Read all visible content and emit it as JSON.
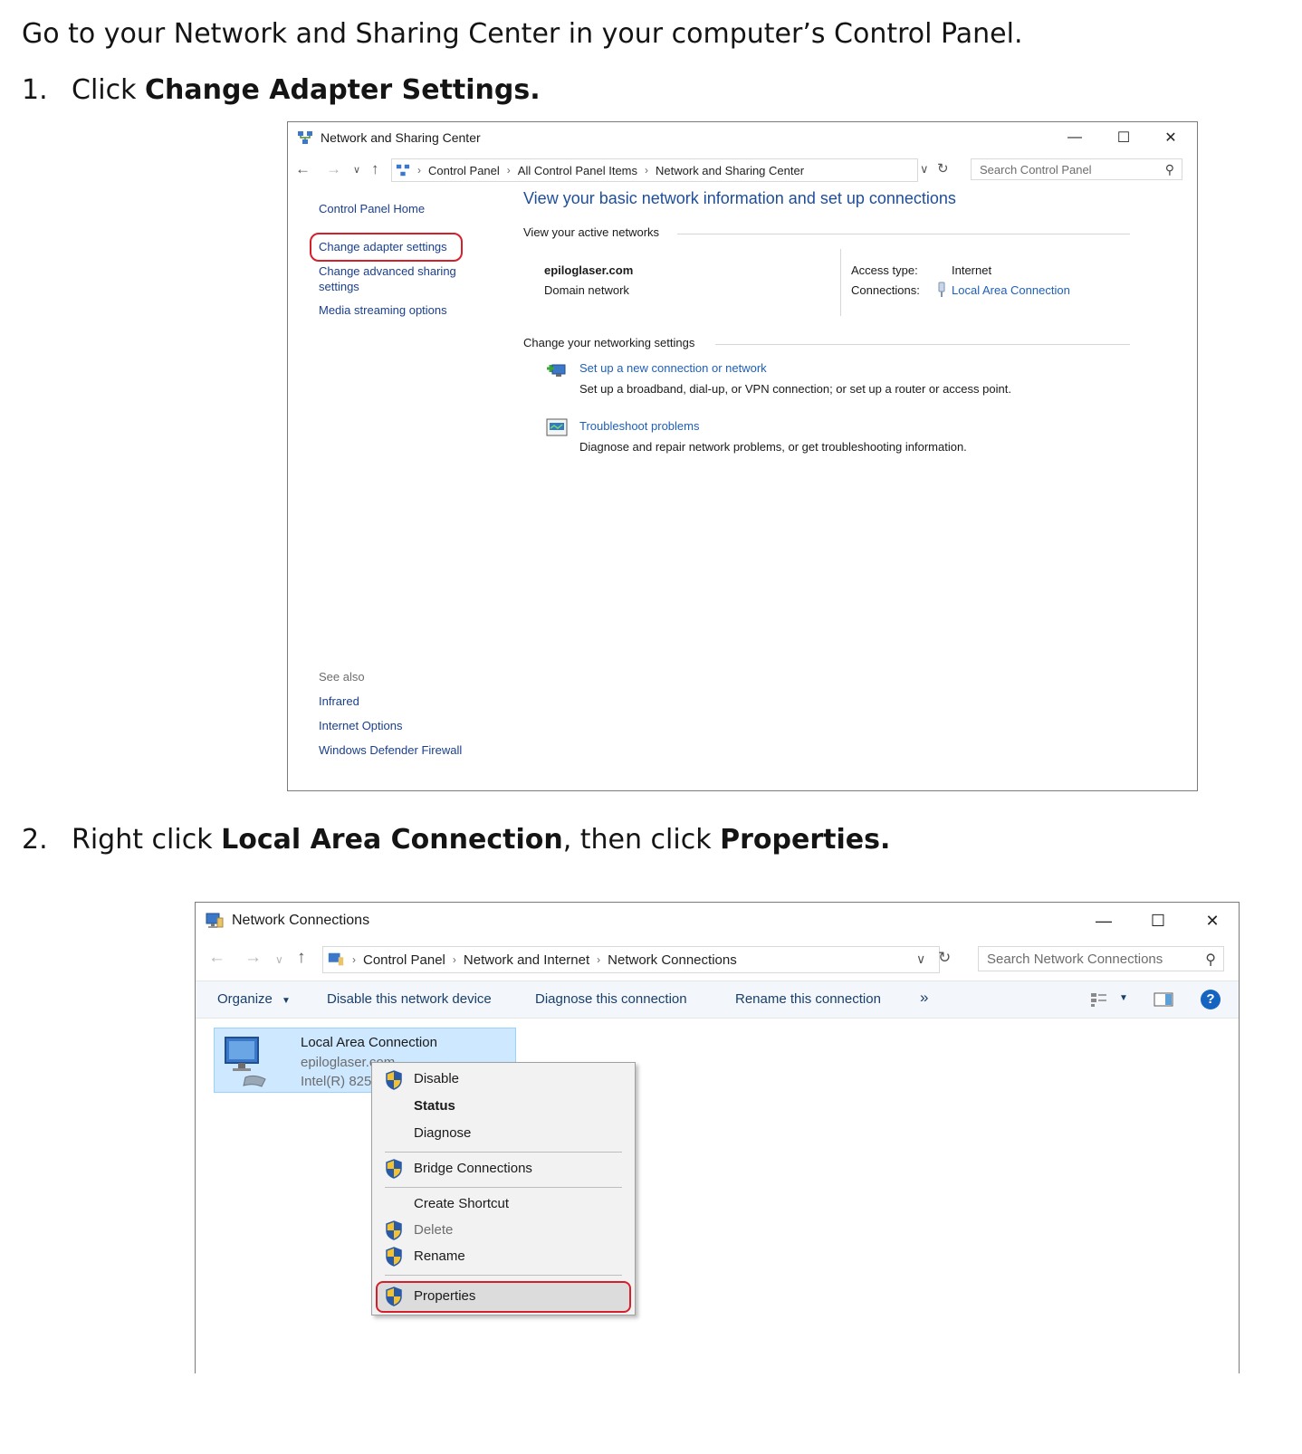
{
  "intro": "Go to your Network and Sharing Center in your computer’s Control Panel.",
  "step1": {
    "num": "1.",
    "prefix": "Click ",
    "bold": "Change Adapter Settings."
  },
  "step2": {
    "num": "2.",
    "prefix": "Right click ",
    "bold1": "Local Area Connection",
    "middle": ", then click ",
    "bold2": "Properties."
  },
  "window1": {
    "title": "Network and Sharing Center",
    "controls": {
      "minimize": "—",
      "maximize": "☐",
      "close": "✕"
    },
    "breadcrumb": [
      "Control Panel",
      "All Control Panel Items",
      "Network and Sharing Center"
    ],
    "search_placeholder": "Search Control Panel",
    "left_nav": {
      "home": "Control Panel Home",
      "adapter": "Change adapter settings",
      "advanced_line1": "Change advanced sharing",
      "advanced_line2": "settings",
      "media": "Media streaming options",
      "see_also": "See also",
      "infrared": "Infrared",
      "internet_options": "Internet Options",
      "firewall": "Windows Defender Firewall"
    },
    "main_title": "View your basic network information and set up connections",
    "active_networks_label": "View your active networks",
    "network_name": "epiloglaser.com",
    "network_type": "Domain network",
    "access_type_label": "Access type:",
    "access_type_value": "Internet",
    "connections_label": "Connections:",
    "connections_value": "Local Area Connection",
    "change_settings_label": "Change your networking settings",
    "setup_link": "Set up a new connection or network",
    "setup_desc": "Set up a broadband, dial-up, or VPN connection; or set up a router or access point.",
    "troubleshoot_link": "Troubleshoot problems",
    "troubleshoot_desc": "Diagnose and repair network problems, or get troubleshooting information."
  },
  "window2": {
    "title": "Network Connections",
    "breadcrumb": [
      "Control Panel",
      "Network and Internet",
      "Network Connections"
    ],
    "search_placeholder": "Search Network Connections",
    "toolbar": {
      "organize": "Organize",
      "disable": "Disable this network device",
      "diagnose": "Diagnose this connection",
      "rename": "Rename this connection",
      "more": "»"
    },
    "connection": {
      "name": "Local Area Connection",
      "domain": "epiloglaser.com",
      "adapter": "Intel(R) 82579l"
    },
    "context_menu": [
      "Disable",
      "Status",
      "Diagnose",
      "Bridge Connections",
      "Create Shortcut",
      "Delete",
      "Rename",
      "Properties"
    ]
  },
  "colors": {
    "highlight": "#d4202a",
    "link": "#1e5fb8",
    "selection": "#cde8ff"
  }
}
